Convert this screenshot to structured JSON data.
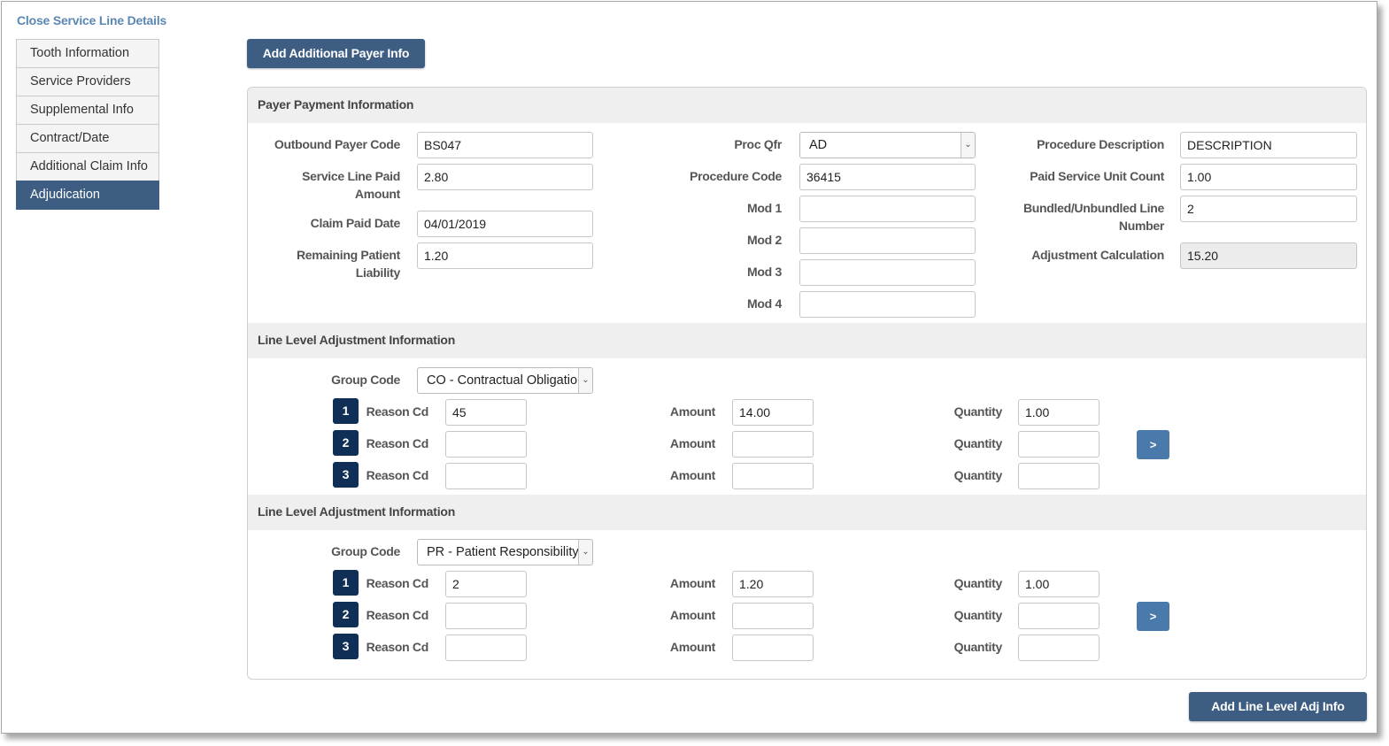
{
  "title": "Close Service Line Details",
  "sidebar": {
    "items": [
      {
        "label": "Tooth Information"
      },
      {
        "label": "Service Providers"
      },
      {
        "label": "Supplemental Info"
      },
      {
        "label": "Contract/Date"
      },
      {
        "label": "Additional Claim Info"
      },
      {
        "label": "Adjudication",
        "active": true
      }
    ]
  },
  "buttons": {
    "add_payer": "Add Additional Payer Info",
    "add_line_adj": "Add Line Level Adj Info",
    "next": ">"
  },
  "payer_payment": {
    "heading": "Payer Payment Information",
    "outbound_payer_code": {
      "label": "Outbound Payer Code",
      "value": "BS047"
    },
    "service_line_paid": {
      "label": "Service Line Paid Amount",
      "value": "2.80"
    },
    "claim_paid_date": {
      "label": "Claim Paid Date",
      "value": "04/01/2019"
    },
    "remaining_patient": {
      "label": "Remaining Patient Liability",
      "value": "1.20"
    },
    "proc_qfr": {
      "label": "Proc Qfr",
      "value": "AD"
    },
    "procedure_code": {
      "label": "Procedure Code",
      "value": "36415"
    },
    "mod1": {
      "label": "Mod 1",
      "value": ""
    },
    "mod2": {
      "label": "Mod 2",
      "value": ""
    },
    "mod3": {
      "label": "Mod 3",
      "value": ""
    },
    "mod4": {
      "label": "Mod 4",
      "value": ""
    },
    "procedure_description": {
      "label": "Procedure Description",
      "value": "DESCRIPTION"
    },
    "paid_service_unit_count": {
      "label": "Paid Service Unit Count",
      "value": "1.00"
    },
    "bundled_line_number": {
      "label": "Bundled/Unbundled Line Number",
      "value": "2"
    },
    "adjustment_calculation": {
      "label": "Adjustment Calculation",
      "value": "15.20"
    }
  },
  "labels": {
    "group_code": "Group Code",
    "reason_cd": "Reason Cd",
    "amount": "Amount",
    "quantity": "Quantity"
  },
  "adjustments": [
    {
      "heading": "Line Level Adjustment Information",
      "group_code": "CO - Contractual Obligation",
      "rows": [
        {
          "num": "1",
          "reason": "45",
          "amount": "14.00",
          "quantity": "1.00"
        },
        {
          "num": "2",
          "reason": "",
          "amount": "",
          "quantity": ""
        },
        {
          "num": "3",
          "reason": "",
          "amount": "",
          "quantity": ""
        }
      ]
    },
    {
      "heading": "Line Level Adjustment Information",
      "group_code": "PR - Patient Responsibility",
      "rows": [
        {
          "num": "1",
          "reason": "2",
          "amount": "1.20",
          "quantity": "1.00"
        },
        {
          "num": "2",
          "reason": "",
          "amount": "",
          "quantity": ""
        },
        {
          "num": "3",
          "reason": "",
          "amount": "",
          "quantity": ""
        }
      ]
    }
  ]
}
